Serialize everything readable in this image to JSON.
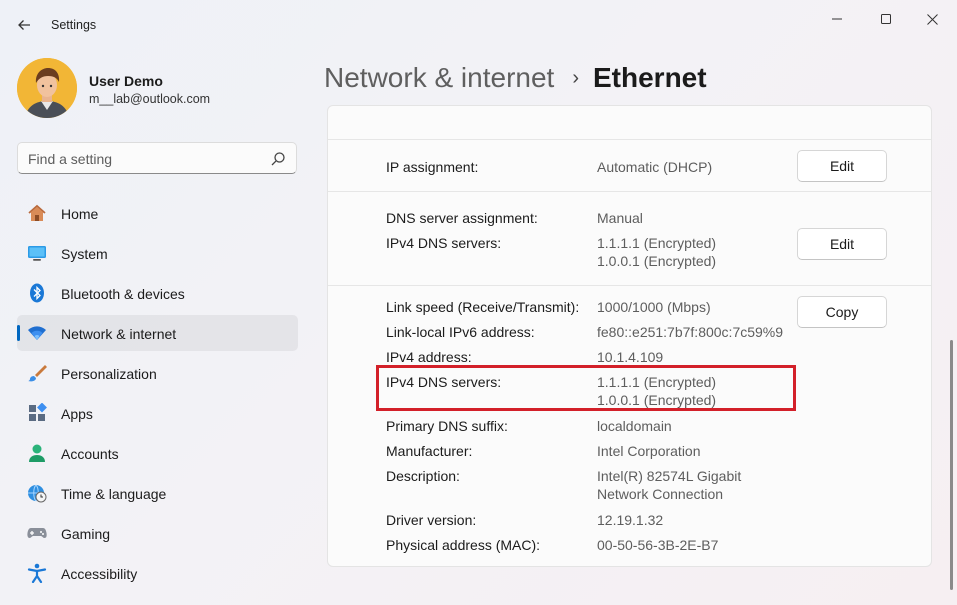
{
  "window": {
    "title": "Settings",
    "back_icon": "arrow-left-icon",
    "controls": [
      "minimize-icon",
      "maximize-icon",
      "close-icon"
    ]
  },
  "profile": {
    "name": "User Demo",
    "email": "m__lab@outlook.com",
    "avatar": "avatar-person"
  },
  "search": {
    "placeholder": "Find a setting",
    "icon": "search-icon"
  },
  "nav": {
    "items": [
      {
        "label": "Home",
        "icon": "home-icon"
      },
      {
        "label": "System",
        "icon": "system-icon"
      },
      {
        "label": "Bluetooth & devices",
        "icon": "bluetooth-icon"
      },
      {
        "label": "Network & internet",
        "icon": "wifi-icon",
        "selected": true
      },
      {
        "label": "Personalization",
        "icon": "brush-icon"
      },
      {
        "label": "Apps",
        "icon": "apps-icon"
      },
      {
        "label": "Accounts",
        "icon": "person-icon"
      },
      {
        "label": "Time & language",
        "icon": "globe-clock-icon"
      },
      {
        "label": "Gaming",
        "icon": "gamepad-icon"
      },
      {
        "label": "Accessibility",
        "icon": "accessibility-icon"
      }
    ]
  },
  "breadcrumb": {
    "parent": "Network & internet",
    "separator": "›",
    "current": "Ethernet"
  },
  "ip_section": {
    "ip_assignment_label": "IP assignment:",
    "ip_assignment_value": "Automatic (DHCP)",
    "edit_label": "Edit"
  },
  "dns_section": {
    "dns_assignment_label": "DNS server assignment:",
    "dns_assignment_value": "Manual",
    "ipv4_dns_label": "IPv4 DNS servers:",
    "ipv4_dns_value_1": "1.1.1.1 (Encrypted)",
    "ipv4_dns_value_2": "1.0.0.1 (Encrypted)",
    "edit_label": "Edit"
  },
  "properties": {
    "copy_label": "Copy",
    "link_speed_label": "Link speed (Receive/Transmit):",
    "link_speed_value": "1000/1000 (Mbps)",
    "ipv6_label": "Link-local IPv6 address:",
    "ipv6_value": "fe80::e251:7b7f:800c:7c59%9",
    "ipv4_label": "IPv4 address:",
    "ipv4_value": "10.1.4.109",
    "dns_label": "IPv4 DNS servers:",
    "dns_value_1": "1.1.1.1 (Encrypted)",
    "dns_value_2": "1.0.0.1 (Encrypted)",
    "dns_suffix_label": "Primary DNS suffix:",
    "dns_suffix_value": "localdomain",
    "manufacturer_label": "Manufacturer:",
    "manufacturer_value": "Intel Corporation",
    "description_label": "Description:",
    "description_value_1": "Intel(R) 82574L Gigabit",
    "description_value_2": "Network Connection",
    "driver_label": "Driver version:",
    "driver_value": "12.19.1.32",
    "mac_label": "Physical address (MAC):",
    "mac_value": "00-50-56-3B-2E-B7"
  },
  "colors": {
    "accent": "#0067c0",
    "highlight_box": "#d32029"
  }
}
